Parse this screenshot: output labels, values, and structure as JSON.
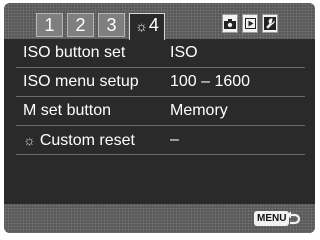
{
  "tabs": [
    {
      "label": "1"
    },
    {
      "label": "2"
    },
    {
      "label": "3"
    },
    {
      "label": "4",
      "icon": "custom-gear-icon",
      "active": true
    }
  ],
  "mode_icons": [
    "camera-icon",
    "playback-icon",
    "setup-wrench-icon"
  ],
  "menu": {
    "rows": [
      {
        "label": "ISO button set",
        "value": "ISO"
      },
      {
        "label": "ISO menu setup",
        "value": "100 – 1600"
      },
      {
        "label": "M set button",
        "value": "Memory"
      },
      {
        "label": "Custom reset",
        "value": "–",
        "icon": "custom-gear-icon"
      }
    ]
  },
  "footer": {
    "menu_key": "MENU",
    "return_icon": "return-arrow-icon"
  },
  "colors": {
    "background": "#2a2a2a",
    "bar": "#5a5a5a",
    "text": "#ffffff"
  }
}
